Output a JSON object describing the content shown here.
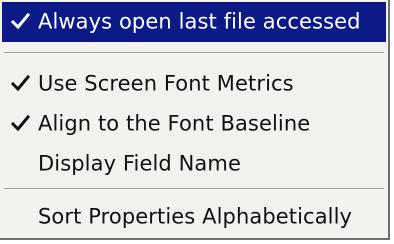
{
  "menu": {
    "items": [
      {
        "label": "Always open last file accessed",
        "checked": true,
        "highlighted": true
      },
      {
        "label": "Use Screen Font Metrics",
        "checked": true
      },
      {
        "label": "Align to the Font Baseline",
        "checked": true
      },
      {
        "label": "Display Field Name",
        "checked": false
      },
      {
        "label": "Sort Properties Alphabetically",
        "checked": false
      }
    ],
    "icons": {
      "check": "checkmark-icon"
    },
    "colors": {
      "highlight_bg": "#0b1a86",
      "highlight_text": "#ffffff",
      "menu_bg": "#f4f2ee",
      "text": "#111111"
    }
  }
}
